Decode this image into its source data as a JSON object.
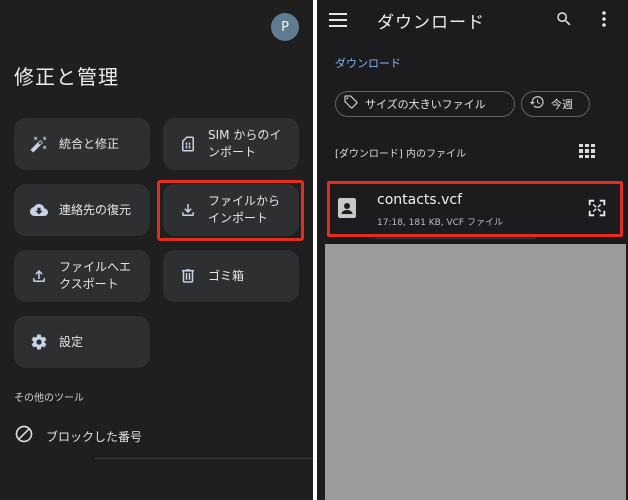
{
  "left": {
    "avatar_letter": "P",
    "title": "修正と管理",
    "tiles": {
      "merge": {
        "label": "統合と修正",
        "icon": "magic-wand-icon"
      },
      "sim": {
        "label": "SIM からのインポート",
        "icon": "sim-card-icon"
      },
      "restore": {
        "label": "連絡先の復元",
        "icon": "cloud-download-icon"
      },
      "import": {
        "label": "ファイルからインポート",
        "icon": "download-icon"
      },
      "export": {
        "label": "ファイルへエクスポート",
        "icon": "upload-icon"
      },
      "trash": {
        "label": "ゴミ箱",
        "icon": "trash-icon"
      },
      "settings": {
        "label": "設定",
        "icon": "gear-icon"
      }
    },
    "other_tools_title": "その他のツール",
    "blocked": {
      "label": "ブロックした番号",
      "icon": "block-icon"
    }
  },
  "right": {
    "title": "ダウンロード",
    "breadcrumb": "ダウンロード",
    "chips": [
      {
        "label": "サイズの大きいファイル",
        "icon": "tag-icon"
      },
      {
        "label": "今週",
        "icon": "history-icon"
      }
    ],
    "section_label": "[ダウンロード] 内のファイル",
    "file": {
      "name": "contacts.vcf",
      "meta": "17:18, 181 KB, VCF ファイル",
      "icon": "contact-card-icon"
    }
  },
  "colors": {
    "highlight": "#e22d1f",
    "link": "#8ab4f8",
    "background": "#1f1f1f",
    "tile": "#2e2f31"
  }
}
